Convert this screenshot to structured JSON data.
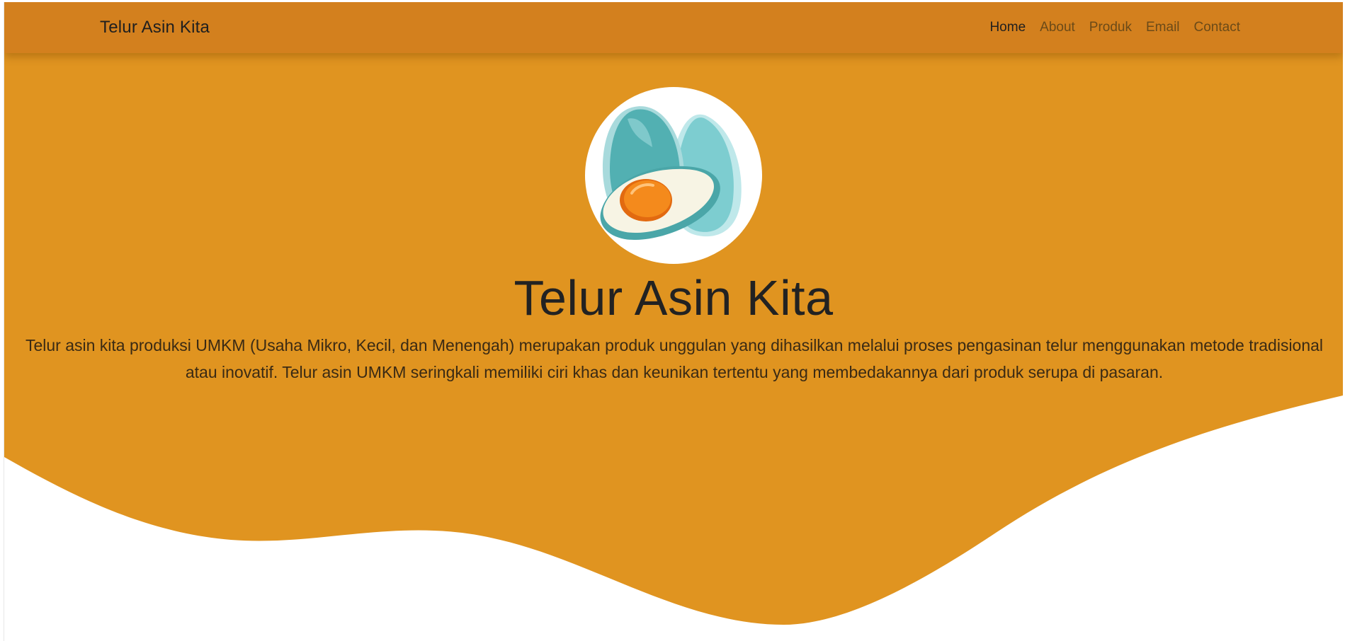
{
  "navbar": {
    "brand": "Telur Asin Kita",
    "links": [
      {
        "label": "Home",
        "active": true
      },
      {
        "label": "About",
        "active": false
      },
      {
        "label": "Produk",
        "active": false
      },
      {
        "label": "Email",
        "active": false
      },
      {
        "label": "Contact",
        "active": false
      }
    ]
  },
  "hero": {
    "logo_icon": "salted-egg-icon",
    "title": "Telur Asin Kita",
    "description": "Telur asin kita produksi UMKM (Usaha Mikro, Kecil, dan Menengah) merupakan produk unggulan yang dihasilkan melalui proses pengasinan telur menggunakan metode tradisional atau inovatif. Telur asin UMKM seringkali memiliki ciri khas dan keunikan tertentu yang membedakannya dari produk serupa di pasaran."
  },
  "colors": {
    "navbar": "#d3801e",
    "hero": "#e09420",
    "wave_bottom": "#ffffff",
    "egg_shell": "#5bb5b6",
    "egg_yolk": "#f07d18"
  }
}
